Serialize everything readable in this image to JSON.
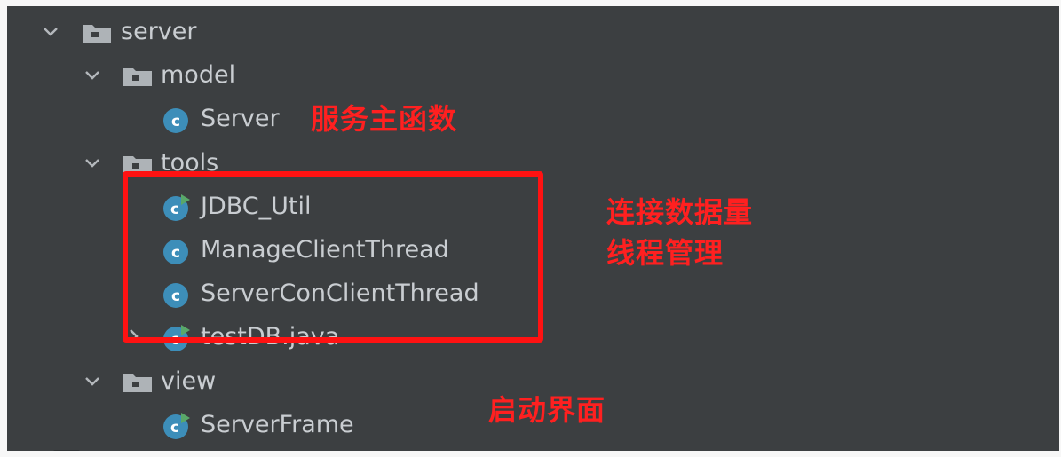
{
  "tree": {
    "server": {
      "label": "server",
      "icon": "folder-icon"
    },
    "model": {
      "label": "model",
      "icon": "folder-icon"
    },
    "server_class": {
      "label": "Server",
      "icon": "java-class-icon"
    },
    "tools": {
      "label": "tools",
      "icon": "folder-icon"
    },
    "jdbc_util": {
      "label": "JDBC_Util",
      "icon": "java-runnable-class-icon"
    },
    "manage_client_thread": {
      "label": "ManageClientThread",
      "icon": "java-class-icon"
    },
    "server_con_client_thread": {
      "label": "ServerConClientThread",
      "icon": "java-class-icon"
    },
    "test_db": {
      "label": "testDB.java",
      "icon": "java-runnable-class-icon"
    },
    "view": {
      "label": "view",
      "icon": "folder-icon"
    },
    "server_frame": {
      "label": "ServerFrame",
      "icon": "java-runnable-class-icon"
    }
  },
  "annotations": {
    "main_function": "服务主函数",
    "db_connection": "连接数据量",
    "thread_management": "线程管理",
    "launch_ui": "启动界面"
  },
  "colors": {
    "panel_background": "#3c3f41",
    "text": "#c9cdd1",
    "annotation": "#ff2020",
    "class_icon": "#3d8eb9",
    "runnable_badge": "#59a869"
  }
}
